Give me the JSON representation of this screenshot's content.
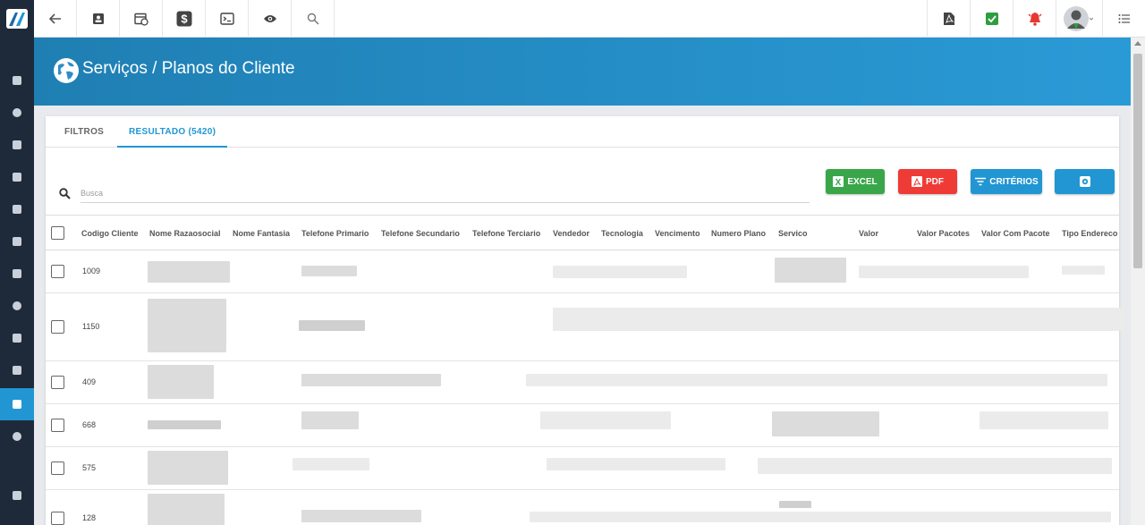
{
  "page": {
    "title": "Serviços / Planos do Cliente"
  },
  "tabs": [
    {
      "label": "FILTROS"
    },
    {
      "label": "RESULTADO (5420)"
    }
  ],
  "search": {
    "placeholder": "Busca"
  },
  "buttons": {
    "excel": "EXCEL",
    "pdf": "PDF",
    "criterios": "CRITÉRIOS"
  },
  "colors": {
    "accent": "#2196d3",
    "excel": "#3aa64a",
    "pdf": "#ef3b36",
    "criterios": "#2196d3",
    "sidebar": "#1e2a3a"
  },
  "table": {
    "columns": [
      "Codigo Cliente",
      "Nome Razaosocial",
      "Nome Fantasia",
      "Telefone Primario",
      "Telefone Secundario",
      "Telefone Terciario",
      "Vendedor",
      "Tecnologia",
      "Vencimento",
      "Numero Plano",
      "Servico",
      "Valor",
      "Valor Pacotes",
      "Valor Com Pacote",
      "Tipo Endereco"
    ],
    "rows": [
      {
        "code": "1009"
      },
      {
        "code": "1150"
      },
      {
        "code": "409"
      },
      {
        "code": "668"
      },
      {
        "code": "575"
      },
      {
        "code": "128"
      }
    ]
  },
  "toolbar_icons": [
    "back-arrow-icon",
    "contact-card-icon",
    "calendar-clock-icon",
    "dollar-icon",
    "terminal-icon",
    "eye-icon",
    "search-icon"
  ],
  "toolbar_right_icons": [
    "pdf-file-icon",
    "check-approval-icon",
    "alarm-bell-icon",
    "user-avatar-icon",
    "menu-list-icon"
  ]
}
